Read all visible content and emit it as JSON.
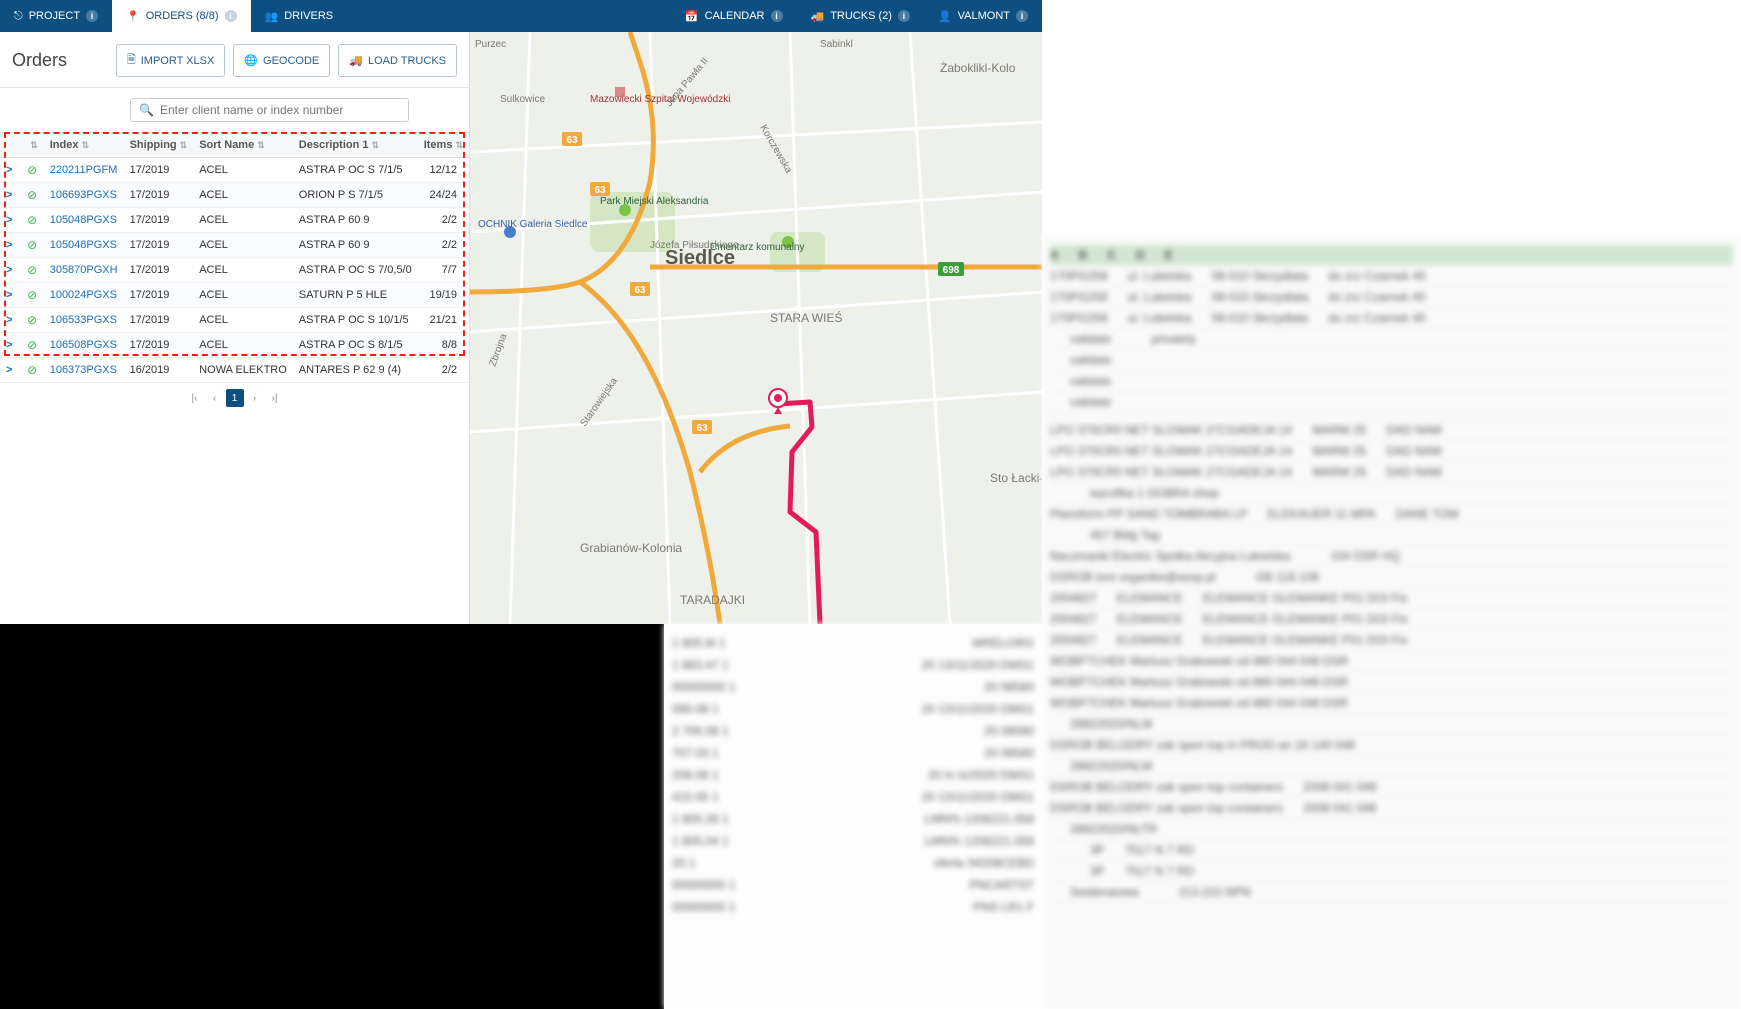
{
  "nav": {
    "project": "PROJECT",
    "orders": "ORDERS (8/8)",
    "drivers": "DRIVERS",
    "calendar": "CALENDAR",
    "trucks": "TRUCKS (2)",
    "valmont": "VALMONT"
  },
  "panel": {
    "title": "Orders",
    "import": "IMPORT XLSX",
    "geocode": "GEOCODE",
    "load": "LOAD TRUCKS",
    "search_placeholder": "Enter client name or index number"
  },
  "table": {
    "headers": {
      "index": "Index",
      "shipping": "Shipping",
      "sortname": "Sort Name",
      "description": "Description 1",
      "items": "Items"
    },
    "rows": [
      {
        "exp": ">",
        "idx": "220211PGFM",
        "ship": "17/2019",
        "sort": "ACEL",
        "desc": "ASTRA P OC S 7/1/5",
        "items": "12/12"
      },
      {
        "exp": ">",
        "idx": "106693PGXS",
        "ship": "17/2019",
        "sort": "ACEL",
        "desc": "ORION P S 7/1/5",
        "items": "24/24"
      },
      {
        "exp": ">",
        "idx": "105048PGXS",
        "ship": "17/2019",
        "sort": "ACEL",
        "desc": "ASTRA P 60 9",
        "items": "2/2"
      },
      {
        "exp": ">",
        "idx": "105048PGXS",
        "ship": "17/2019",
        "sort": "ACEL",
        "desc": "ASTRA P 60 9",
        "items": "2/2"
      },
      {
        "exp": ">",
        "idx": "305870PGXH",
        "ship": "17/2019",
        "sort": "ACEL",
        "desc": "ASTRA P OC S 7/0,5/0",
        "items": "7/7"
      },
      {
        "exp": ">",
        "idx": "100024PGXS",
        "ship": "17/2019",
        "sort": "ACEL",
        "desc": "SATURN P 5 HLE",
        "items": "19/19"
      },
      {
        "exp": ">",
        "idx": "106533PGXS",
        "ship": "17/2019",
        "sort": "ACEL",
        "desc": "ASTRA P OC S 10/1/5",
        "items": "21/21"
      },
      {
        "exp": ">",
        "idx": "106508PGXS",
        "ship": "17/2019",
        "sort": "ACEL",
        "desc": "ASTRA P OC S 8/1/5",
        "items": "8/8"
      },
      {
        "exp": ">",
        "idx": "106373PGXS",
        "ship": "16/2019",
        "sort": "NOWA ELEKTRO",
        "desc": "ANTARES P 62 9 (4)",
        "items": "2/2"
      }
    ],
    "page": "1"
  },
  "map": {
    "city": "Siedlce",
    "labels": {
      "stara_wies": "STARA WIEŚ",
      "taradajki": "TARADAJKI",
      "grabianow": "Grabianów-Kolonia",
      "zaboklikl": "Żaboklikl-Kolo",
      "sto_lacki": "Sto Łacki-Fo",
      "sabinkl": "Sabinkl",
      "purzec": "Purzec",
      "sulkowice": "Sulkowice",
      "cmentarz": "Cmentarz komunalny",
      "park": "Park Miejski Aleksandria",
      "ochnik": "OCHNIK Galeria Siedlce",
      "szpital": "Mazowiecki Szpital Wojewódzki",
      "zbrojna": "Zbrojna",
      "starowiejska": "Starowiejska",
      "jpilsud": "Józefa Piłsudskiego",
      "jpawla": "Jana Pawła II",
      "korczewska": "Korczewska",
      "r63a": "63",
      "r63b": "63",
      "r63c": "63",
      "r698": "698"
    }
  }
}
